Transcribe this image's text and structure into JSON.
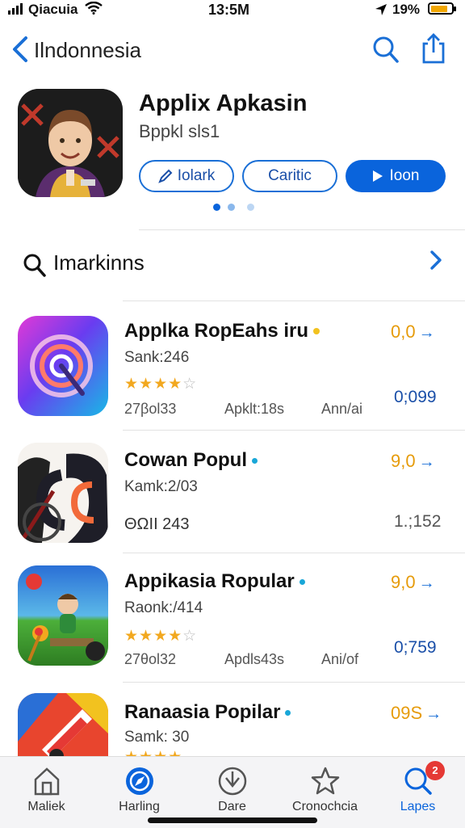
{
  "status_bar": {
    "carrier": "Qiacuia",
    "time": "13:5M",
    "battery_percent": "19%"
  },
  "nav": {
    "back_label": "Ilndonnesia"
  },
  "app": {
    "title": "Applix Apkasin",
    "subtitle": "Bppkl sls1",
    "buttons": [
      "Iolark",
      "Caritic",
      "Ioon"
    ]
  },
  "section": {
    "title": "Imarkinns"
  },
  "rows": [
    {
      "name": "Applka RopEahs iru",
      "rank": "Sank:246",
      "stars": 4,
      "meta1": "27βol33",
      "meta2": "Apklt:18s",
      "meta3": "Αnn/ai",
      "price": "0,0",
      "number": "0;099",
      "number_style": "blue"
    },
    {
      "name": "Cowan Popul",
      "rank": "Kamk:2/03",
      "stars": null,
      "meta1": "ΘΩΙΙ 243",
      "meta2": "",
      "meta3": "",
      "price": "9,0",
      "number": "1.;152",
      "number_style": "grey"
    },
    {
      "name": "Appikasia Ropular",
      "rank": "Raonk:/414",
      "stars": 4,
      "meta1": "27θol32",
      "meta2": "Apdls43s",
      "meta3": "Αni/of",
      "price": "9,0",
      "number": "0;759",
      "number_style": "blue"
    },
    {
      "name": "Ranaasia Popilar",
      "rank": "Samk: 30",
      "stars": 4,
      "meta1": "",
      "meta2": "",
      "meta3": "",
      "price": "09S",
      "number": "",
      "number_style": "blue"
    }
  ],
  "tabs": [
    {
      "label": "Maliek",
      "icon": "house-icon",
      "active": false
    },
    {
      "label": "Harling",
      "icon": "compass-icon",
      "active": true
    },
    {
      "label": "Dare",
      "icon": "download-icon",
      "active": false
    },
    {
      "label": "Cronochcia",
      "icon": "star-icon",
      "active": false
    },
    {
      "label": "Lapes",
      "icon": "search-icon",
      "active": true
    }
  ],
  "badge_count": "2",
  "colors": {
    "accent": "#0a64dc",
    "star": "#f2a81f",
    "price": "#e69b0a",
    "badge": "#e53935"
  }
}
